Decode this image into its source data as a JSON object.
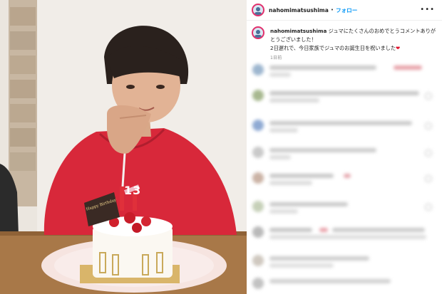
{
  "post": {
    "username": "nahomimatsushima",
    "follow_label": "フォロー",
    "more_icon": "more-options-icon",
    "caption_line1": "ジュマにたくさんのおめでとうコメントありがとうございました！",
    "caption_line2": "2日遅れで、今日家族でジュマのお誕生日を祝いました",
    "caption_heart": "❤",
    "timestamp": "1日前"
  },
  "photo": {
    "cake_plaque_text": "Happy Birthday",
    "candle_number": "13"
  },
  "colors": {
    "follow_blue": "#0095f6",
    "ring": "#e1306c",
    "hoodie_red": "#d8283a",
    "heart_red": "#e0112b"
  }
}
